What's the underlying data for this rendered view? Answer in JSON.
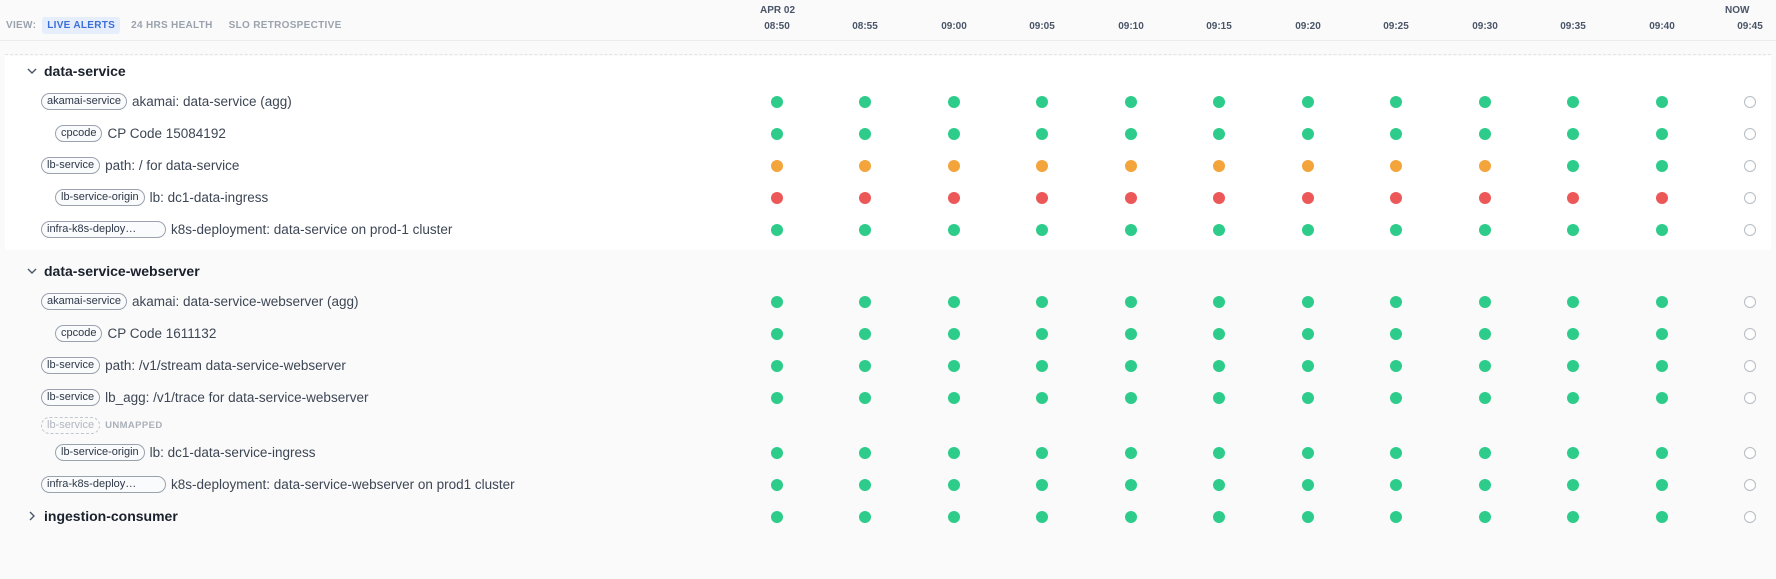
{
  "header": {
    "view_label": "VIEW:",
    "tabs": [
      {
        "label": "LIVE ALERTS",
        "active": true
      },
      {
        "label": "24 HRS HEALTH",
        "active": false
      },
      {
        "label": "SLO RETROSPECTIVE",
        "active": false
      }
    ],
    "date": "APR 02",
    "now": "NOW",
    "times": [
      "08:50",
      "08:55",
      "09:00",
      "09:05",
      "09:10",
      "09:15",
      "09:20",
      "09:25",
      "09:30",
      "09:35",
      "09:40",
      "09:45"
    ]
  },
  "status_colors": {
    "green": "#2dcc8a",
    "orange": "#f3a43b",
    "red": "#ec5858",
    "empty": "#b6bcc3"
  },
  "groups": [
    {
      "title": "data-service",
      "expanded": true,
      "rows": [
        {
          "tag": "akamai-service",
          "text": "akamai: data-service (agg)",
          "indent": 0,
          "statuses": [
            "green",
            "green",
            "green",
            "green",
            "green",
            "green",
            "green",
            "green",
            "green",
            "green",
            "green",
            "empty"
          ]
        },
        {
          "tag": "cpcode",
          "text": "CP Code 15084192",
          "indent": 1,
          "statuses": [
            "green",
            "green",
            "green",
            "green",
            "green",
            "green",
            "green",
            "green",
            "green",
            "green",
            "green",
            "empty"
          ]
        },
        {
          "tag": "lb-service",
          "text": "path: / for data-service",
          "indent": 0,
          "statuses": [
            "orange",
            "orange",
            "orange",
            "orange",
            "orange",
            "orange",
            "orange",
            "orange",
            "orange",
            "green",
            "green",
            "empty"
          ]
        },
        {
          "tag": "lb-service-origin",
          "text": "lb: dc1-data-ingress",
          "indent": 1,
          "statuses": [
            "red",
            "red",
            "red",
            "red",
            "red",
            "red",
            "red",
            "red",
            "red",
            "red",
            "red",
            "empty"
          ]
        },
        {
          "tag": "infra-k8s-deploy…",
          "text": "k8s-deployment: data-service on prod-1 cluster",
          "indent": 0,
          "truncated": true,
          "statuses": [
            "green",
            "green",
            "green",
            "green",
            "green",
            "green",
            "green",
            "green",
            "green",
            "green",
            "green",
            "empty"
          ]
        }
      ]
    },
    {
      "title": "data-service-webserver",
      "expanded": true,
      "rows": [
        {
          "tag": "akamai-service",
          "text": "akamai: data-service-webserver (agg)",
          "indent": 0,
          "statuses": [
            "green",
            "green",
            "green",
            "green",
            "green",
            "green",
            "green",
            "green",
            "green",
            "green",
            "green",
            "empty"
          ]
        },
        {
          "tag": "cpcode",
          "text": "CP Code 1611132",
          "indent": 1,
          "statuses": [
            "green",
            "green",
            "green",
            "green",
            "green",
            "green",
            "green",
            "green",
            "green",
            "green",
            "green",
            "empty"
          ]
        },
        {
          "tag": "lb-service",
          "text": "path: /v1/stream data-service-webserver",
          "indent": 0,
          "statuses": [
            "green",
            "green",
            "green",
            "green",
            "green",
            "green",
            "green",
            "green",
            "green",
            "green",
            "green",
            "empty"
          ]
        },
        {
          "tag": "lb-service",
          "text": "lb_agg: /v1/trace for data-service-webserver",
          "indent": 0,
          "statuses": [
            "green",
            "green",
            "green",
            "green",
            "green",
            "green",
            "green",
            "green",
            "green",
            "green",
            "green",
            "empty"
          ]
        },
        {
          "tag": "lb-service",
          "text": "",
          "indent": 0,
          "unmapped": true,
          "unmapped_label": "UNMAPPED",
          "statuses": []
        },
        {
          "tag": "lb-service-origin",
          "text": "lb: dc1-data-service-ingress",
          "indent": 1,
          "statuses": [
            "green",
            "green",
            "green",
            "green",
            "green",
            "green",
            "green",
            "green",
            "green",
            "green",
            "green",
            "empty"
          ]
        },
        {
          "tag": "infra-k8s-deploy…",
          "text": "k8s-deployment: data-service-webserver on prod1 cluster",
          "indent": 0,
          "truncated": true,
          "statuses": [
            "green",
            "green",
            "green",
            "green",
            "green",
            "green",
            "green",
            "green",
            "green",
            "green",
            "green",
            "empty"
          ]
        }
      ]
    },
    {
      "title": "ingestion-consumer",
      "expanded": false,
      "statuses": [
        "green",
        "green",
        "green",
        "green",
        "green",
        "green",
        "green",
        "green",
        "green",
        "green",
        "green",
        "empty"
      ],
      "rows": []
    }
  ]
}
